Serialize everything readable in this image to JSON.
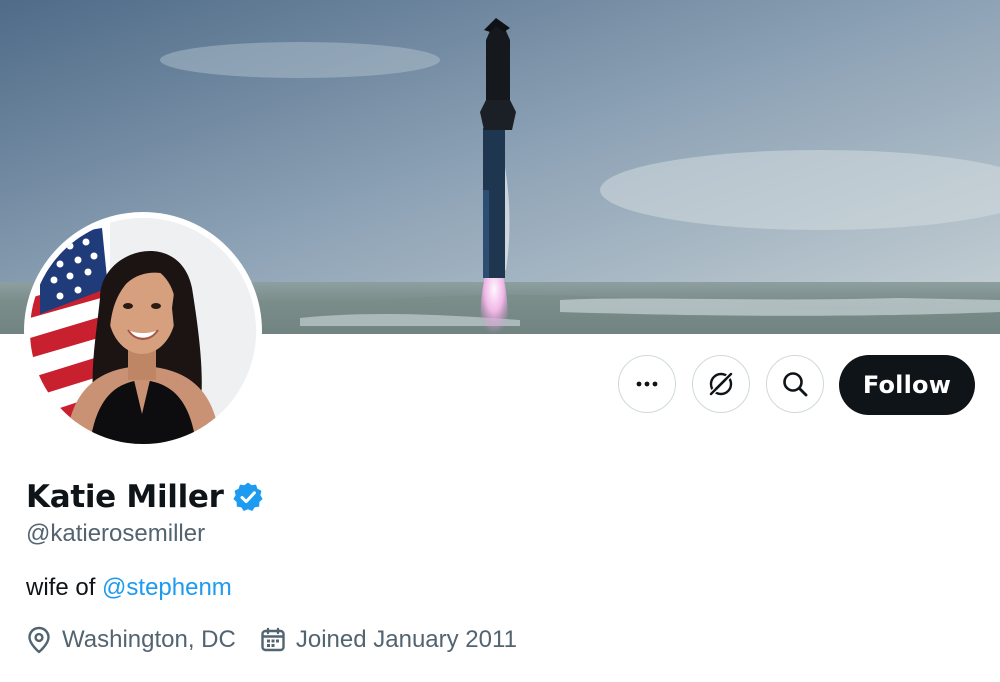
{
  "profile": {
    "display_name": "Katie Miller",
    "handle": "@katierosemiller",
    "verified": true,
    "bio": {
      "prefix": "wife of ",
      "mention": "@stephenm"
    },
    "location": "Washington, DC",
    "joined": "Joined January 2011"
  },
  "actions": {
    "more_icon": "more-horizontal-icon",
    "grok_icon": "grok-icon",
    "search_icon": "search-icon",
    "follow_label": "Follow"
  },
  "colors": {
    "accent": "#1d9bf0",
    "primary_text": "#0f1419",
    "secondary_text": "#536471",
    "border": "#cfd9de",
    "follow_bg": "#0f1419"
  }
}
